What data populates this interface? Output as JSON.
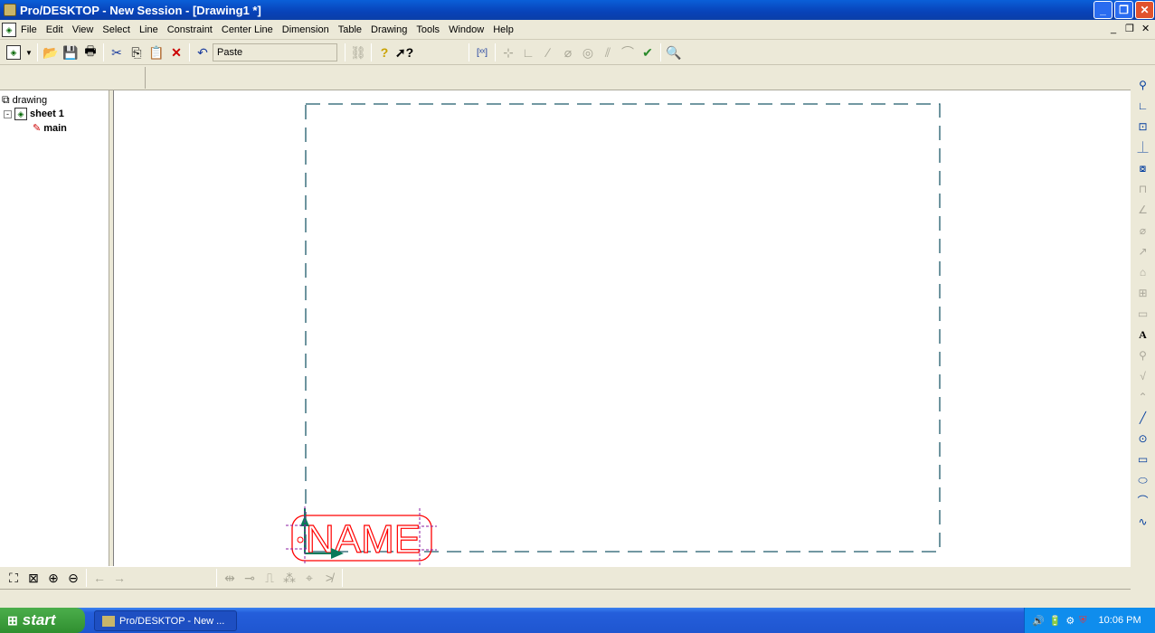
{
  "window": {
    "title": "Pro/DESKTOP - New Session - [Drawing1 *]",
    "minimize": "_",
    "restore": "❐",
    "close": "✕"
  },
  "menu": [
    "File",
    "Edit",
    "View",
    "Select",
    "Line",
    "Constraint",
    "Center Line",
    "Dimension",
    "Table",
    "Drawing",
    "Tools",
    "Window",
    "Help"
  ],
  "toolbar": {
    "command_box": "Paste"
  },
  "tree": {
    "root": "drawing",
    "sheet": "sheet 1",
    "view": "main"
  },
  "drawing": {
    "logo_text": "NAME",
    "frame_color": "#1f5b6b",
    "logo_color": "#ff0000"
  },
  "taskbar": {
    "start": "start",
    "task": "Pro/DESKTOP - New ...",
    "clock": "10:06 PM"
  }
}
